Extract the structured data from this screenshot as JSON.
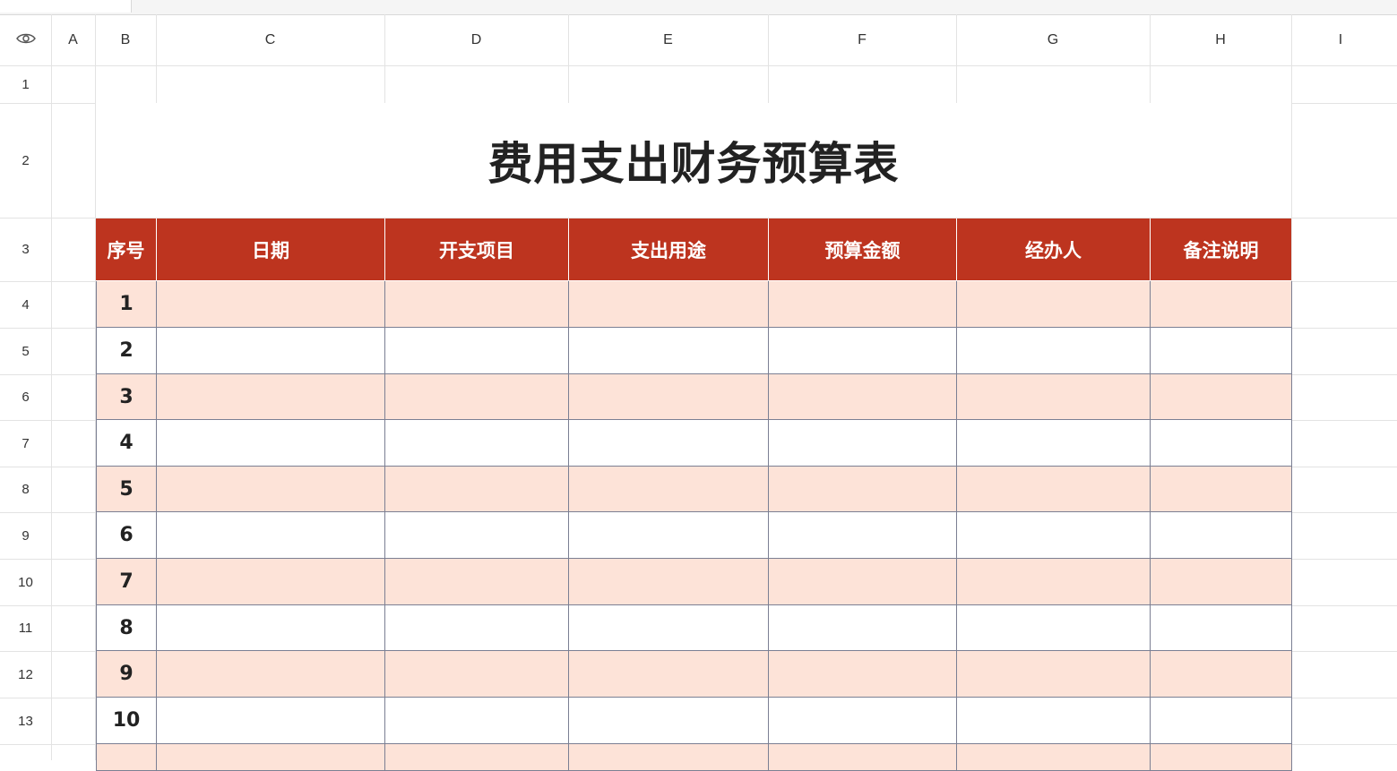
{
  "sheet": {
    "columns": [
      "A",
      "B",
      "C",
      "D",
      "E",
      "F",
      "G",
      "H",
      "I"
    ],
    "rows": [
      "1",
      "2",
      "3",
      "4",
      "5",
      "6",
      "7",
      "8",
      "9",
      "10",
      "11",
      "12",
      "13"
    ],
    "corner_icon": "eye-icon"
  },
  "table": {
    "title": "费用支出财务预算表",
    "headers": [
      "序号",
      "日期",
      "开支项目",
      "支出用途",
      "预算金额",
      "经办人",
      "备注说明"
    ],
    "row_numbers": [
      "1",
      "2",
      "3",
      "4",
      "5",
      "6",
      "7",
      "8",
      "9",
      "10"
    ],
    "colors": {
      "header_bg": "#bd341f",
      "band_bg": "#fde3d8",
      "border": "#7b7f93"
    }
  }
}
